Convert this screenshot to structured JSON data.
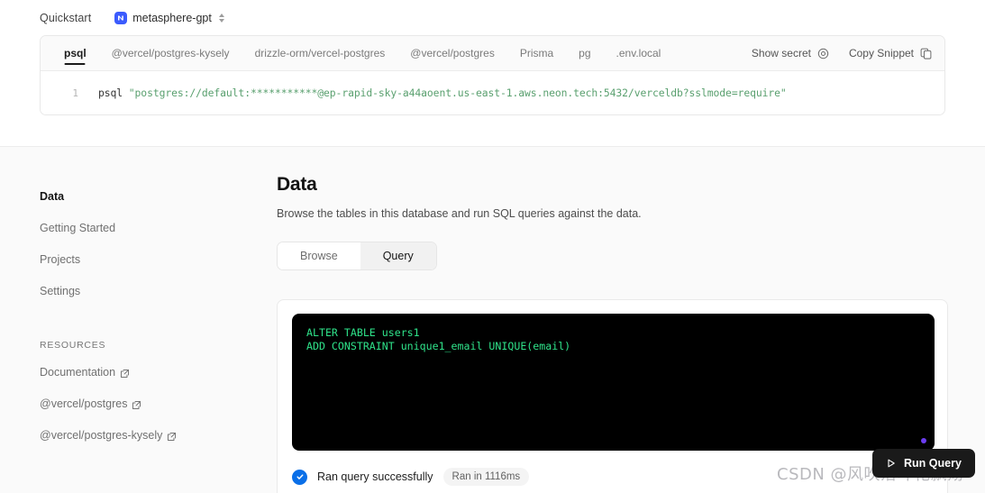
{
  "quickstart": {
    "title": "Quickstart",
    "database_name": "metasphere-gpt",
    "selector_icon": "neon-logo-icon",
    "chevron_icon": "chevron-up-down-icon"
  },
  "snippet": {
    "tabs": [
      {
        "label": "psql",
        "active": true
      },
      {
        "label": "@vercel/postgres-kysely",
        "active": false
      },
      {
        "label": "drizzle-orm/vercel-postgres",
        "active": false
      },
      {
        "label": "@vercel/postgres",
        "active": false
      },
      {
        "label": "Prisma",
        "active": false
      },
      {
        "label": "pg",
        "active": false
      },
      {
        "label": ".env.local",
        "active": false
      }
    ],
    "show_secret_label": "Show secret",
    "show_secret_icon": "eye-icon",
    "copy_snippet_label": "Copy Snippet",
    "copy_snippet_icon": "copy-icon",
    "line_number": "1",
    "code_command": "psql",
    "code_string": "\"postgres://default:***********@ep-rapid-sky-a44aoent.us-east-1.aws.neon.tech:5432/verceldb?sslmode=require\""
  },
  "sidebar": {
    "items": [
      {
        "label": "Data",
        "active": true
      },
      {
        "label": "Getting Started",
        "active": false
      },
      {
        "label": "Projects",
        "active": false
      },
      {
        "label": "Settings",
        "active": false
      }
    ],
    "resources_label": "RESOURCES",
    "resources": [
      {
        "label": "Documentation"
      },
      {
        "label": "@vercel/postgres"
      },
      {
        "label": "@vercel/postgres-kysely"
      }
    ],
    "external_icon": "external-link-icon"
  },
  "main": {
    "title": "Data",
    "description": "Browse the tables in this database and run SQL queries against the data.",
    "tabs": [
      {
        "label": "Browse",
        "active": false
      },
      {
        "label": "Query",
        "active": true
      }
    ]
  },
  "editor": {
    "line1": "ALTER TABLE users1",
    "line2": "ADD CONSTRAINT unique1_email UNIQUE(email)",
    "cursor_color": "#6b3df0"
  },
  "status": {
    "icon": "check-circle-icon",
    "message": "Ran query successfully",
    "timing": "Ran in 1116ms",
    "accent_color": "#0a6fe8"
  },
  "actions": {
    "run_query_label": "Run Query",
    "run_query_icon": "play-icon"
  },
  "watermark": {
    "text": "CSDN @风吹落叶花飘荡"
  }
}
